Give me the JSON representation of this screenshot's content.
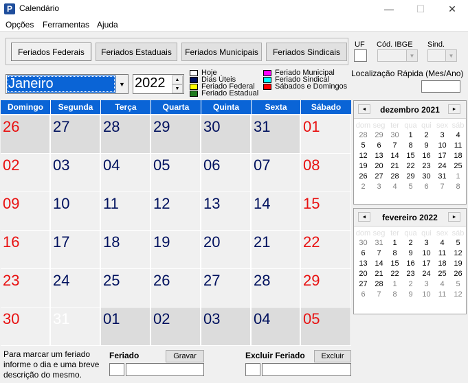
{
  "window": {
    "title": "Calendário",
    "minimize": "—",
    "maximize": "☐",
    "close": "✕",
    "icon_letter": "P"
  },
  "menu": [
    "Opções",
    "Ferramentas",
    "Ajuda"
  ],
  "tabs": [
    "Feriados Federais",
    "Feriados Estaduais",
    "Feriados Municipais",
    "Feriados Sindicais"
  ],
  "filters": {
    "uf_label": "UF",
    "ibge_label": "Cód. IBGE",
    "sind_label": "Sind."
  },
  "month": "Janeiro",
  "year": "2022",
  "legend": [
    {
      "label": "Hoje",
      "color": "#ffffff"
    },
    {
      "label": "Dias Úteis",
      "color": "#00115e"
    },
    {
      "label": "Feriado Federal",
      "color": "#ffff00"
    },
    {
      "label": "Feriado Estadual",
      "color": "#1f7a1f"
    },
    {
      "label": "Feriado Municipal",
      "color": "#ff00ff"
    },
    {
      "label": "Feriado Sindical",
      "color": "#00ffff"
    },
    {
      "label": "Sábados e Domingos",
      "color": "#ff0000"
    }
  ],
  "quick_locate": {
    "label": "Localização Rápida (Mes/Ano)",
    "value": ""
  },
  "weekdays": [
    "Domingo",
    "Segunda",
    "Terça",
    "Quarta",
    "Quinta",
    "Sexta",
    "Sábado"
  ],
  "weeks": [
    [
      "26",
      "27",
      "28",
      "29",
      "30",
      "31",
      "01"
    ],
    [
      "02",
      "03",
      "04",
      "05",
      "06",
      "07",
      "08"
    ],
    [
      "09",
      "10",
      "11",
      "12",
      "13",
      "14",
      "15"
    ],
    [
      "16",
      "17",
      "18",
      "19",
      "20",
      "21",
      "22"
    ],
    [
      "23",
      "24",
      "25",
      "26",
      "27",
      "28",
      "29"
    ],
    [
      "30",
      "31",
      "01",
      "02",
      "03",
      "04",
      "05"
    ]
  ],
  "mini_prev": {
    "title": "dezembro 2021",
    "dow": [
      "dom",
      "seg",
      "ter",
      "qua",
      "qui",
      "sex",
      "sáb"
    ],
    "weeks": [
      [
        "28",
        "29",
        "30",
        "1",
        "2",
        "3",
        "4"
      ],
      [
        "5",
        "6",
        "7",
        "8",
        "9",
        "10",
        "11"
      ],
      [
        "12",
        "13",
        "14",
        "15",
        "16",
        "17",
        "18"
      ],
      [
        "19",
        "20",
        "21",
        "22",
        "23",
        "24",
        "25"
      ],
      [
        "26",
        "27",
        "28",
        "29",
        "30",
        "31",
        "1"
      ],
      [
        "2",
        "3",
        "4",
        "5",
        "6",
        "7",
        "8"
      ]
    ]
  },
  "mini_next": {
    "title": "fevereiro 2022",
    "dow": [
      "dom",
      "seg",
      "ter",
      "qua",
      "qui",
      "sex",
      "sáb"
    ],
    "weeks": [
      [
        "30",
        "31",
        "1",
        "2",
        "3",
        "4",
        "5"
      ],
      [
        "6",
        "7",
        "8",
        "9",
        "10",
        "11",
        "12"
      ],
      [
        "13",
        "14",
        "15",
        "16",
        "17",
        "18",
        "19"
      ],
      [
        "20",
        "21",
        "22",
        "23",
        "24",
        "25",
        "26"
      ],
      [
        "27",
        "28",
        "1",
        "2",
        "3",
        "4",
        "5"
      ],
      [
        "6",
        "7",
        "8",
        "9",
        "10",
        "11",
        "12"
      ]
    ]
  },
  "bottom": {
    "help": "Para marcar um feriado informe o dia e uma breve descrição do mesmo.",
    "feriado_label": "Feriado",
    "gravar": "Gravar",
    "excluir_label": "Excluir Feriado",
    "excluir": "Excluir"
  }
}
